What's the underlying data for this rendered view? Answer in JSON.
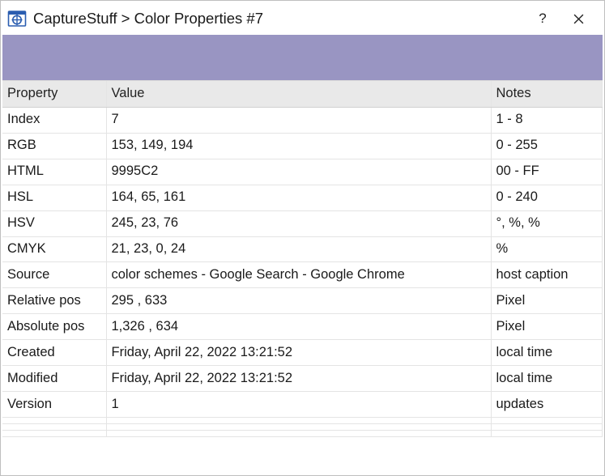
{
  "window": {
    "title": "CaptureStuff > Color Properties #7",
    "help_label": "?",
    "close_label": "Close"
  },
  "swatch": {
    "color_hex": "#9995C2"
  },
  "headers": {
    "property": "Property",
    "value": "Value",
    "notes": "Notes"
  },
  "rows": [
    {
      "property": "Index",
      "value": "7",
      "notes": "1 - 8"
    },
    {
      "property": "RGB",
      "value": "153, 149, 194",
      "notes": "0 - 255"
    },
    {
      "property": "HTML",
      "value": "9995C2",
      "notes": "00 - FF"
    },
    {
      "property": "HSL",
      "value": "164, 65, 161",
      "notes": "0 - 240"
    },
    {
      "property": "HSV",
      "value": "245, 23, 76",
      "notes": "°, %, %"
    },
    {
      "property": "CMYK",
      "value": "21, 23, 0, 24",
      "notes": "%"
    },
    {
      "property": "Source",
      "value": "color schemes - Google Search - Google Chrome",
      "notes": "host caption"
    },
    {
      "property": "Relative pos",
      "value": "295 , 633",
      "notes": "Pixel"
    },
    {
      "property": "Absolute pos",
      "value": "1,326 , 634",
      "notes": "Pixel"
    },
    {
      "property": "Created",
      "value": "Friday, April 22, 2022 13:21:52",
      "notes": "local time"
    },
    {
      "property": "Modified",
      "value": "Friday, April 22, 2022 13:21:52",
      "notes": "local time"
    },
    {
      "property": "Version",
      "value": "1",
      "notes": "updates"
    },
    {
      "property": "",
      "value": "",
      "notes": ""
    },
    {
      "property": "",
      "value": "",
      "notes": ""
    },
    {
      "property": "",
      "value": "",
      "notes": ""
    }
  ]
}
